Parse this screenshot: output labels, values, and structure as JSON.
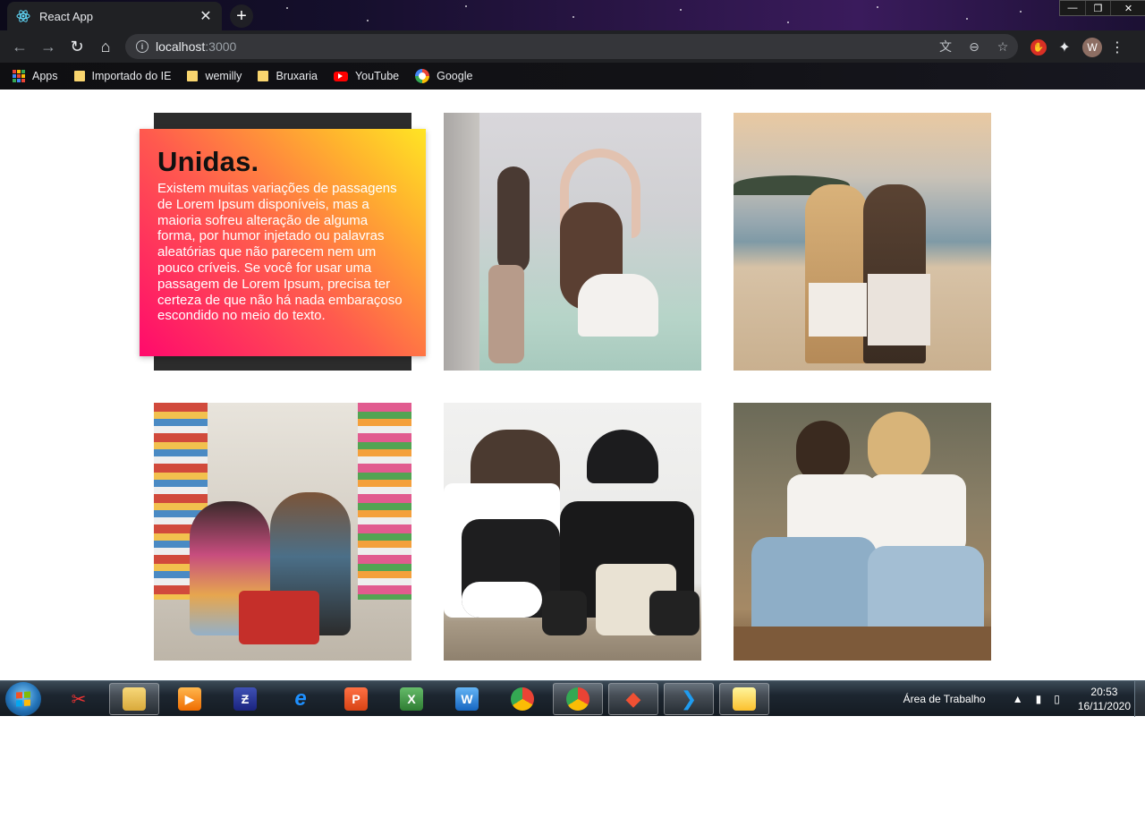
{
  "browser": {
    "tab_title": "React App",
    "tab_close": "✕",
    "new_tab": "+",
    "url_host": "localhost",
    "url_port": ":3000",
    "avatar_letter": "W",
    "window_controls": {
      "minimize": "—",
      "restore": "❐",
      "close": "✕"
    }
  },
  "bookmarks": [
    {
      "label": "Apps",
      "icon": "apps-grid-icon"
    },
    {
      "label": "Importado do IE",
      "icon": "folder-icon"
    },
    {
      "label": "wemilly",
      "icon": "folder-icon"
    },
    {
      "label": "Bruxaria",
      "icon": "folder-icon"
    },
    {
      "label": "YouTube",
      "icon": "youtube-icon"
    },
    {
      "label": "Google",
      "icon": "google-icon"
    }
  ],
  "card": {
    "title": "Unidas.",
    "text": "Existem muitas variações de passagens de Lorem Ipsum disponíveis, mas a maioria sofreu alteração de alguma forma, por humor injetado ou palavras aleatórias que não parecem nem um pouco críveis. Se você for usar uma passagem de Lorem Ipsum, precisa ter certeza de que não há nada embaraçoso escondido no meio do texto."
  },
  "gallery": [
    {
      "name": "photo-friends-hands-arch"
    },
    {
      "name": "photo-friends-beach-heart"
    },
    {
      "name": "photo-friends-supermarket"
    },
    {
      "name": "photo-friends-sneakers"
    },
    {
      "name": "photo-friends-levis"
    }
  ],
  "taskbar": {
    "tray_label": "Área de Trabalho",
    "time": "20:53",
    "date": "16/11/2020"
  },
  "colors": {
    "card_gradient_start": "#ff0a6c",
    "card_gradient_end": "#ffe524",
    "card_back": "#2c2c2c"
  }
}
